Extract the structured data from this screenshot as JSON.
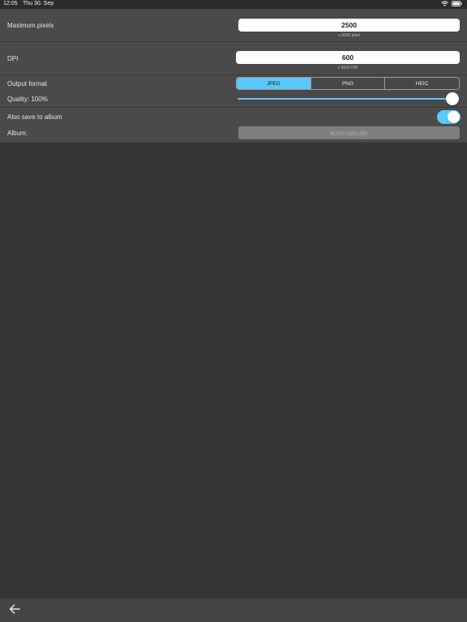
{
  "status_bar": {
    "time": "12:05",
    "date": "Thu 30. Sep"
  },
  "settings": {
    "max_pixels": {
      "label": "Maximum pixels",
      "value": "2500",
      "hint": "≤ 8000 pixel"
    },
    "dpi": {
      "label": "DPI",
      "value": "600",
      "hint": "≤ 5000 DPI"
    },
    "output_format": {
      "label": "Output format",
      "options": [
        "JPEG",
        "PNG",
        "HEIC"
      ],
      "selected": "JPEG"
    },
    "quality": {
      "label": "Quality: 100%",
      "value_percent": 100
    },
    "save_to_album": {
      "label": "Also save to album",
      "enabled": true
    },
    "album": {
      "label": "Album:",
      "placeholder": "automatically"
    }
  },
  "colors": {
    "accent": "#5ac8fa",
    "background": "#353535",
    "panel": "#4a4a4a"
  },
  "toolbar": {
    "back_icon": "arrow-left-icon"
  }
}
